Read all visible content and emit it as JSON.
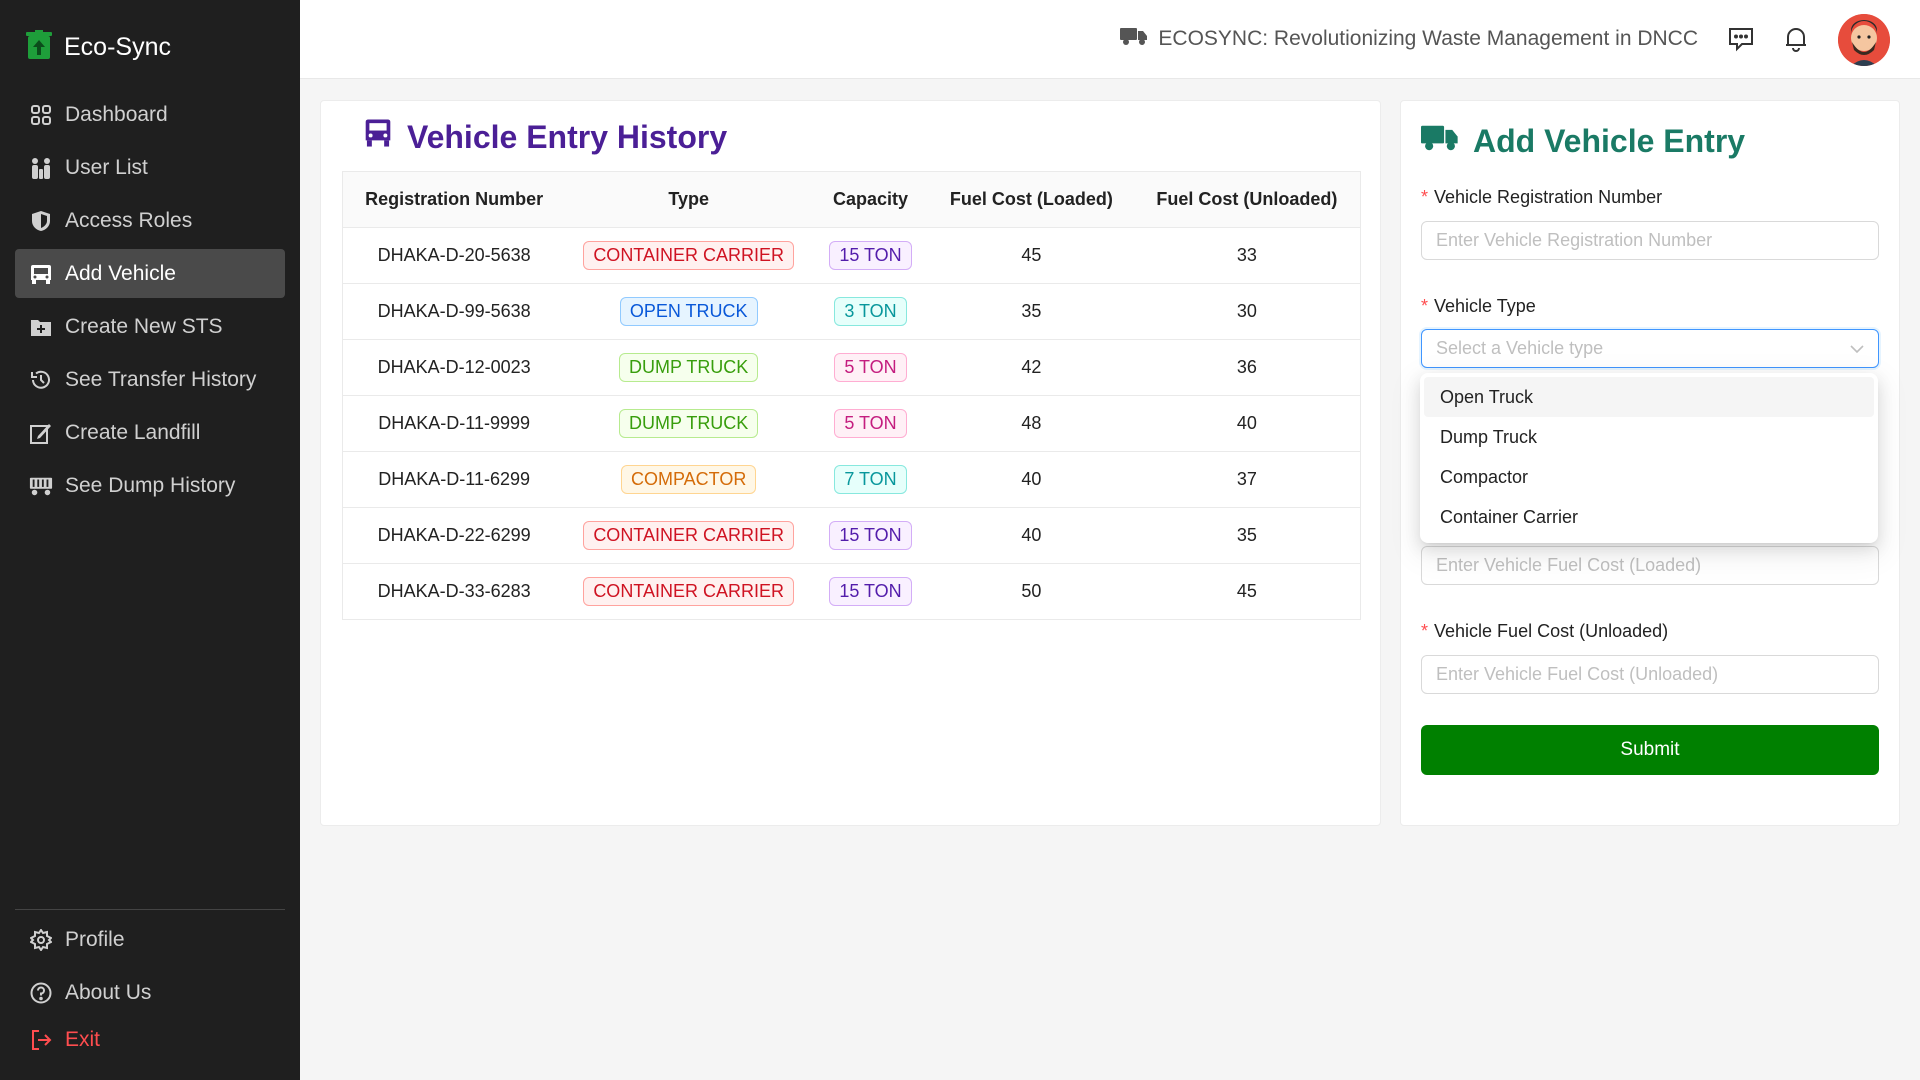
{
  "sidebar": {
    "brand": "Eco-Sync",
    "items": [
      {
        "label": "Dashboard",
        "icon": "dashboard-icon"
      },
      {
        "label": "User List",
        "icon": "users-icon"
      },
      {
        "label": "Access Roles",
        "icon": "shield-icon"
      },
      {
        "label": "Add Vehicle",
        "icon": "bus-icon",
        "active": true
      },
      {
        "label": "Create New STS",
        "icon": "folder-add-icon"
      },
      {
        "label": "See Transfer History",
        "icon": "history-icon"
      },
      {
        "label": "Create Landfill",
        "icon": "edit-icon"
      },
      {
        "label": "See Dump History",
        "icon": "truck-icon"
      }
    ],
    "bottom_items": [
      {
        "label": "Profile",
        "icon": "settings-icon"
      },
      {
        "label": "About Us",
        "icon": "question-icon"
      },
      {
        "label": "Exit",
        "icon": "logout-icon"
      }
    ]
  },
  "header": {
    "title": "ECOSYNC: Revolutionizing Waste Management in DNCC"
  },
  "history": {
    "title": "Vehicle Entry History",
    "columns": [
      "Registration Number",
      "Type",
      "Capacity",
      "Fuel Cost (Loaded)",
      "Fuel Cost (Unloaded)"
    ],
    "rows": [
      {
        "reg": "DHAKA-D-20-5638",
        "type": "CONTAINER CARRIER",
        "type_color": "red",
        "capacity": "15 TON",
        "cap_color": "purple",
        "loaded": "45",
        "unloaded": "33"
      },
      {
        "reg": "DHAKA-D-99-5638",
        "type": "OPEN TRUCK",
        "type_color": "blue",
        "capacity": "3 TON",
        "cap_color": "cyan",
        "loaded": "35",
        "unloaded": "30"
      },
      {
        "reg": "DHAKA-D-12-0023",
        "type": "DUMP TRUCK",
        "type_color": "green",
        "capacity": "5 TON",
        "cap_color": "magenta",
        "loaded": "42",
        "unloaded": "36"
      },
      {
        "reg": "DHAKA-D-11-9999",
        "type": "DUMP TRUCK",
        "type_color": "green",
        "capacity": "5 TON",
        "cap_color": "magenta",
        "loaded": "48",
        "unloaded": "40"
      },
      {
        "reg": "DHAKA-D-11-6299",
        "type": "COMPACTOR",
        "type_color": "orange",
        "capacity": "7 TON",
        "cap_color": "cyan",
        "loaded": "40",
        "unloaded": "37"
      },
      {
        "reg": "DHAKA-D-22-6299",
        "type": "CONTAINER CARRIER",
        "type_color": "red",
        "capacity": "15 TON",
        "cap_color": "purple",
        "loaded": "40",
        "unloaded": "35"
      },
      {
        "reg": "DHAKA-D-33-6283",
        "type": "CONTAINER CARRIER",
        "type_color": "red",
        "capacity": "15 TON",
        "cap_color": "purple",
        "loaded": "50",
        "unloaded": "45"
      }
    ]
  },
  "form": {
    "title": "Add Vehicle Entry",
    "reg_label": "Vehicle Registration Number",
    "reg_placeholder": "Enter Vehicle Registration Number",
    "type_label": "Vehicle Type",
    "type_placeholder": "Select a Vehicle type",
    "type_options": [
      "Open Truck",
      "Dump Truck",
      "Compactor",
      "Container Carrier"
    ],
    "loaded_placeholder": "Enter Vehicle Fuel Cost (Loaded)",
    "unloaded_label": "Vehicle Fuel Cost (Unloaded)",
    "unloaded_placeholder": "Enter Vehicle Fuel Cost (Unloaded)",
    "submit_label": "Submit"
  },
  "colors": {
    "sidebar_bg": "#1f1f1f",
    "history_title": "#4b1f96",
    "form_title": "#1a7a65",
    "submit_bg": "#008000",
    "exit": "#ff4d4f"
  }
}
